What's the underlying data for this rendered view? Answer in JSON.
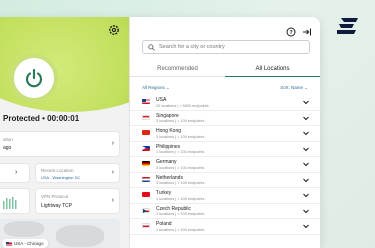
{
  "brand": {
    "logo_icon": "expressvpn-logo-icon"
  },
  "left": {
    "connection_status": "Protected • 00:00:01",
    "current_location": {
      "label": "ation",
      "value": "ago"
    },
    "recent_location": {
      "label": "Recent Location",
      "value": "USA - Washington DC"
    },
    "vpn_protocol": {
      "label": "VPN Protocol",
      "value": "Lightway TCP"
    },
    "map_pin_label": "USA - Chicago"
  },
  "right": {
    "search_placeholder": "Search for a city or country",
    "tabs": [
      {
        "label": "Recommended",
        "active": false
      },
      {
        "label": "All Locations",
        "active": true
      }
    ],
    "filter_left": "All Regions",
    "filter_right": "Sort: Name",
    "locations": [
      {
        "name": "USA",
        "sub": "20 locations | > 5000 endpoints",
        "flag": "us"
      },
      {
        "name": "Singapore",
        "sub": "3 locations | > 100 endpoints",
        "flag": "sg"
      },
      {
        "name": "Hong Kong",
        "sub": "3 locations | > 100 endpoints",
        "flag": "hk"
      },
      {
        "name": "Philippines",
        "sub": "1 locations | > 100 endpoints",
        "flag": "ph"
      },
      {
        "name": "Germany",
        "sub": "3 locations | > 100 endpoints",
        "flag": "de"
      },
      {
        "name": "Netherlands",
        "sub": "3 locations | > 100 endpoints",
        "flag": "nl"
      },
      {
        "name": "Turkey",
        "sub": "1 locations | > 100 endpoints",
        "flag": "tr"
      },
      {
        "name": "Czech Republic",
        "sub": "1 locations | > 100 endpoints",
        "flag": "cz"
      },
      {
        "name": "Poland",
        "sub": "1 locations | > 100 endpoints",
        "flag": "pl"
      }
    ]
  },
  "colors": {
    "accent": "#2c7a55",
    "hero_green": "#c2df5d",
    "link_blue": "#2c6e9a"
  }
}
